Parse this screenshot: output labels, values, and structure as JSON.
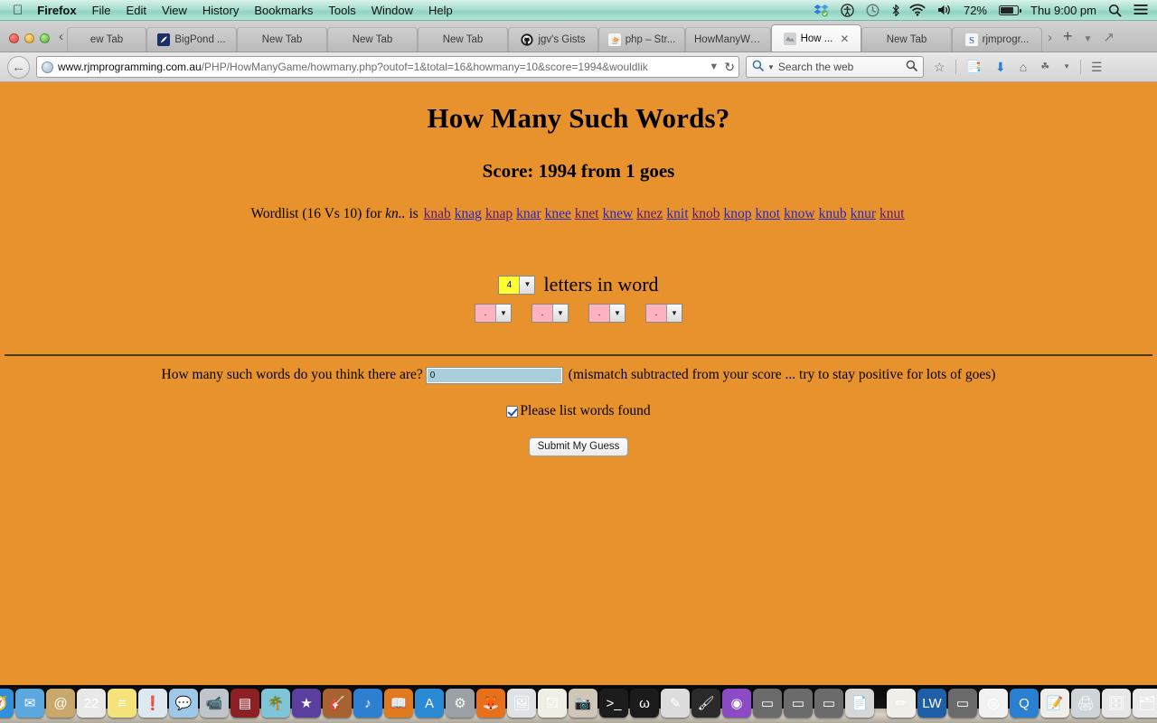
{
  "menubar": {
    "apple_icon": "apple-icon",
    "items": [
      {
        "label": "Firefox",
        "bold": true
      },
      {
        "label": "File",
        "bold": false
      },
      {
        "label": "Edit",
        "bold": false
      },
      {
        "label": "View",
        "bold": false
      },
      {
        "label": "History",
        "bold": false
      },
      {
        "label": "Bookmarks",
        "bold": false
      },
      {
        "label": "Tools",
        "bold": false
      },
      {
        "label": "Window",
        "bold": false
      },
      {
        "label": "Help",
        "bold": false
      }
    ],
    "status": {
      "dropbox_icon": "dropbox-icon",
      "accessibility_icon": "accessibility-icon",
      "timemachine_icon": "time-machine-icon",
      "bluetooth_icon": "bluetooth-icon",
      "wifi_icon": "wifi-icon",
      "volume_icon": "volume-icon",
      "battery_percent": "72%",
      "battery_icon": "battery-icon",
      "clock": "Thu 9:00 pm",
      "spotlight_icon": "search-icon",
      "notifications_icon": "notification-center-icon"
    }
  },
  "browser": {
    "window_controls": {
      "close": "close-button",
      "minimize": "minimize-button",
      "zoom": "zoom-button"
    },
    "tab_scroll_left_icon": "chevron-left-icon",
    "tab_scroll_right_icon": "chevron-right-icon",
    "new_tab_icon": "plus-icon",
    "tab_list_icon": "chevron-down-icon",
    "fullscreen_icon": "fullscreen-icon",
    "tabs": [
      {
        "label": "ew Tab",
        "favicon": "none",
        "active": false,
        "clipped": true
      },
      {
        "label": "BigPond ...",
        "favicon": "bigpond-icon",
        "active": false
      },
      {
        "label": "New Tab",
        "favicon": "none",
        "active": false
      },
      {
        "label": "New Tab",
        "favicon": "none",
        "active": false
      },
      {
        "label": "New Tab",
        "favicon": "none",
        "active": false
      },
      {
        "label": "jgv's Gists",
        "favicon": "github-icon",
        "active": false
      },
      {
        "label": "php – Str...",
        "favicon": "stackoverflow-icon",
        "active": false
      },
      {
        "label": "HowManyWo...",
        "favicon": "none",
        "active": false
      },
      {
        "label": "How ...",
        "favicon": "page-icon",
        "active": true,
        "close_icon": "close-icon"
      },
      {
        "label": "New Tab",
        "favicon": "none",
        "active": false
      },
      {
        "label": "rjmprogr...",
        "favicon": "rjm-icon",
        "active": false
      }
    ],
    "navigation": {
      "back_icon": "back-arrow-icon",
      "url_host": "www.rjmprogramming.com.au",
      "url_path": "/PHP/HowManyGame/howmany.php?outof=1&total=16&howmany=10&score=1994&wouldlik",
      "site_icon": "globe-icon",
      "dropdown_icon": "chevron-down-icon",
      "reload_icon": "reload-icon"
    },
    "search": {
      "search_icon": "search-icon",
      "engine_dropdown_icon": "chevron-down-icon",
      "placeholder": "Search the web",
      "go_icon": "search-go-icon"
    },
    "toolbar_icons": [
      {
        "name": "bookmark-star-icon"
      },
      {
        "name": "reader-list-icon"
      },
      {
        "name": "downloads-icon"
      },
      {
        "name": "home-icon"
      },
      {
        "name": "pocket-icon"
      },
      {
        "name": "overflow-chevron-icon"
      },
      {
        "name": "hamburger-menu-icon"
      }
    ]
  },
  "page": {
    "background_color": "#e8922e",
    "title": "How Many Such Words?",
    "score_line": "Score: 1994 from 1 goes",
    "wordlist": {
      "prefix_a": "Wordlist (16 Vs 10) for ",
      "pattern": "kn..",
      "prefix_b": " is ",
      "words": [
        {
          "text": "knab",
          "visited": true
        },
        {
          "text": "knag",
          "visited": false
        },
        {
          "text": "knap",
          "visited": true
        },
        {
          "text": "knar",
          "visited": false
        },
        {
          "text": "knee",
          "visited": false
        },
        {
          "text": "knet",
          "visited": true
        },
        {
          "text": "knew",
          "visited": false
        },
        {
          "text": "knez",
          "visited": true
        },
        {
          "text": "knit",
          "visited": false
        },
        {
          "text": "knob",
          "visited": true
        },
        {
          "text": "knop",
          "visited": false
        },
        {
          "text": "knot",
          "visited": false
        },
        {
          "text": "know",
          "visited": false
        },
        {
          "text": "knub",
          "visited": false
        },
        {
          "text": "knur",
          "visited": false
        },
        {
          "text": "knut",
          "visited": true
        }
      ]
    },
    "length_select": {
      "value": "4",
      "label": "letters in word",
      "background_color": "#ffff33"
    },
    "letter_selects": [
      {
        "value": ".",
        "background_color": "#ffb3c1"
      },
      {
        "value": ".",
        "background_color": "#ffb3c1"
      },
      {
        "value": ".",
        "background_color": "#ffb3c1"
      },
      {
        "value": ".",
        "background_color": "#ffb3c1"
      }
    ],
    "guess": {
      "label": "How many such words do you think there are?",
      "value": "0",
      "hint": "(mismatch subtracted from your score ... try to stay positive for lots of goes)",
      "input_background": "#a9cfdd"
    },
    "checkbox": {
      "checked": true,
      "label": "Please list words found"
    },
    "submit_label": "Submit My Guess"
  },
  "dock": {
    "items": [
      {
        "name": "finder-icon",
        "glyph": "☺",
        "bg": "#4da3e0",
        "running": true
      },
      {
        "name": "launchpad-icon",
        "glyph": "🚀",
        "bg": "#b9bdc2",
        "running": false
      },
      {
        "name": "safari-icon",
        "glyph": "🧭",
        "bg": "#2f8fd8",
        "running": false
      },
      {
        "name": "mail-icon",
        "glyph": "✉",
        "bg": "#5aa8dd",
        "running": false
      },
      {
        "name": "contacts-icon",
        "glyph": "@",
        "bg": "#c8a96b",
        "running": false
      },
      {
        "name": "calendar-icon",
        "glyph": "22",
        "bg": "#e8e8e8",
        "running": false
      },
      {
        "name": "notes-icon",
        "glyph": "≡",
        "bg": "#f4e27a",
        "running": false
      },
      {
        "name": "app-store-news-icon",
        "glyph": "❗",
        "bg": "#dde8f0",
        "running": false
      },
      {
        "name": "messages-icon",
        "glyph": "💬",
        "bg": "#9fc7e8",
        "running": false
      },
      {
        "name": "facetime-icon",
        "glyph": "📹",
        "bg": "#bfc5ca",
        "running": false
      },
      {
        "name": "imovie-theater-icon",
        "glyph": "▤",
        "bg": "#8d2024",
        "running": false
      },
      {
        "name": "photos-icon",
        "glyph": "🌴",
        "bg": "#7fc5d8",
        "running": false
      },
      {
        "name": "imovie-star-icon",
        "glyph": "★",
        "bg": "#5b3f9e",
        "running": false
      },
      {
        "name": "garageband-icon",
        "glyph": "🎸",
        "bg": "#a8622f",
        "running": false
      },
      {
        "name": "itunes-icon",
        "glyph": "♪",
        "bg": "#2e7fd0",
        "running": true
      },
      {
        "name": "ibooks-icon",
        "glyph": "📖",
        "bg": "#e07a1f",
        "running": false
      },
      {
        "name": "app-store-icon",
        "glyph": "A",
        "bg": "#2a8ad4",
        "running": false
      },
      {
        "name": "system-preferences-icon",
        "glyph": "⚙",
        "bg": "#9aa0a6",
        "running": false
      },
      {
        "name": "firefox-icon",
        "glyph": "🦊",
        "bg": "#e8701a",
        "running": true
      },
      {
        "name": "preview-icon",
        "glyph": "🖼",
        "bg": "#dfe3e6",
        "running": false
      },
      {
        "name": "reminders-icon",
        "glyph": "☑",
        "bg": "#efefe6",
        "running": false
      },
      {
        "name": "photo-booth-icon",
        "glyph": "📷",
        "bg": "#cfc6b8",
        "running": false
      },
      {
        "name": "terminal-icon",
        "glyph": ">_",
        "bg": "#1c1c1c",
        "running": true
      },
      {
        "name": "wireshark-icon",
        "glyph": "ω",
        "bg": "#1b1b1b",
        "running": false
      },
      {
        "name": "sketchup-icon",
        "glyph": "✎",
        "bg": "#dcdcdc",
        "running": false
      },
      {
        "name": "paintbrush-icon",
        "glyph": "🖌",
        "bg": "#2a2a2a",
        "running": false
      },
      {
        "name": "purple-globe-icon",
        "glyph": "◉",
        "bg": "#8a4bc4",
        "running": false
      },
      {
        "name": "finder-window-1-icon",
        "glyph": "▭",
        "bg": "#6b6b6b",
        "running": false
      },
      {
        "name": "finder-window-2-icon",
        "glyph": "▭",
        "bg": "#6b6b6b",
        "running": false
      },
      {
        "name": "finder-window-3-icon",
        "glyph": "▭",
        "bg": "#6b6b6b",
        "running": false
      },
      {
        "name": "stack-documents-icon",
        "glyph": "📄",
        "bg": "#d7d7d7",
        "running": false
      },
      {
        "name": "textedit-icon",
        "glyph": "✏",
        "bg": "#f0eee8",
        "running": false
      },
      {
        "name": "lightwave-icon",
        "glyph": "LW",
        "bg": "#1f5fa8",
        "running": false
      },
      {
        "name": "finder-window-4-icon",
        "glyph": "▭",
        "bg": "#6b6b6b",
        "running": false
      },
      {
        "name": "chrome-icon",
        "glyph": "◎",
        "bg": "#f2f2f2",
        "running": true
      },
      {
        "name": "quicktime-icon",
        "glyph": "Q",
        "bg": "#2a7fd0",
        "running": false
      },
      {
        "name": "document-pencil-icon",
        "glyph": "📝",
        "bg": "#efeee9",
        "running": false
      },
      {
        "name": "scanner-icon",
        "glyph": "🖨",
        "bg": "#cfd4d8",
        "running": false
      },
      {
        "name": "archive-zip-icon",
        "glyph": "🗄",
        "bg": "#e7e7e7",
        "running": false
      },
      {
        "name": "folder-stack-icon",
        "glyph": "🗂",
        "bg": "#eaeaea",
        "running": false
      },
      {
        "name": "downloads-stack-icon",
        "glyph": "🗃",
        "bg": "#eaeaea",
        "running": false
      },
      {
        "name": "trash-icon",
        "glyph": "🗑",
        "bg": "#b9bec2",
        "running": false
      }
    ]
  }
}
